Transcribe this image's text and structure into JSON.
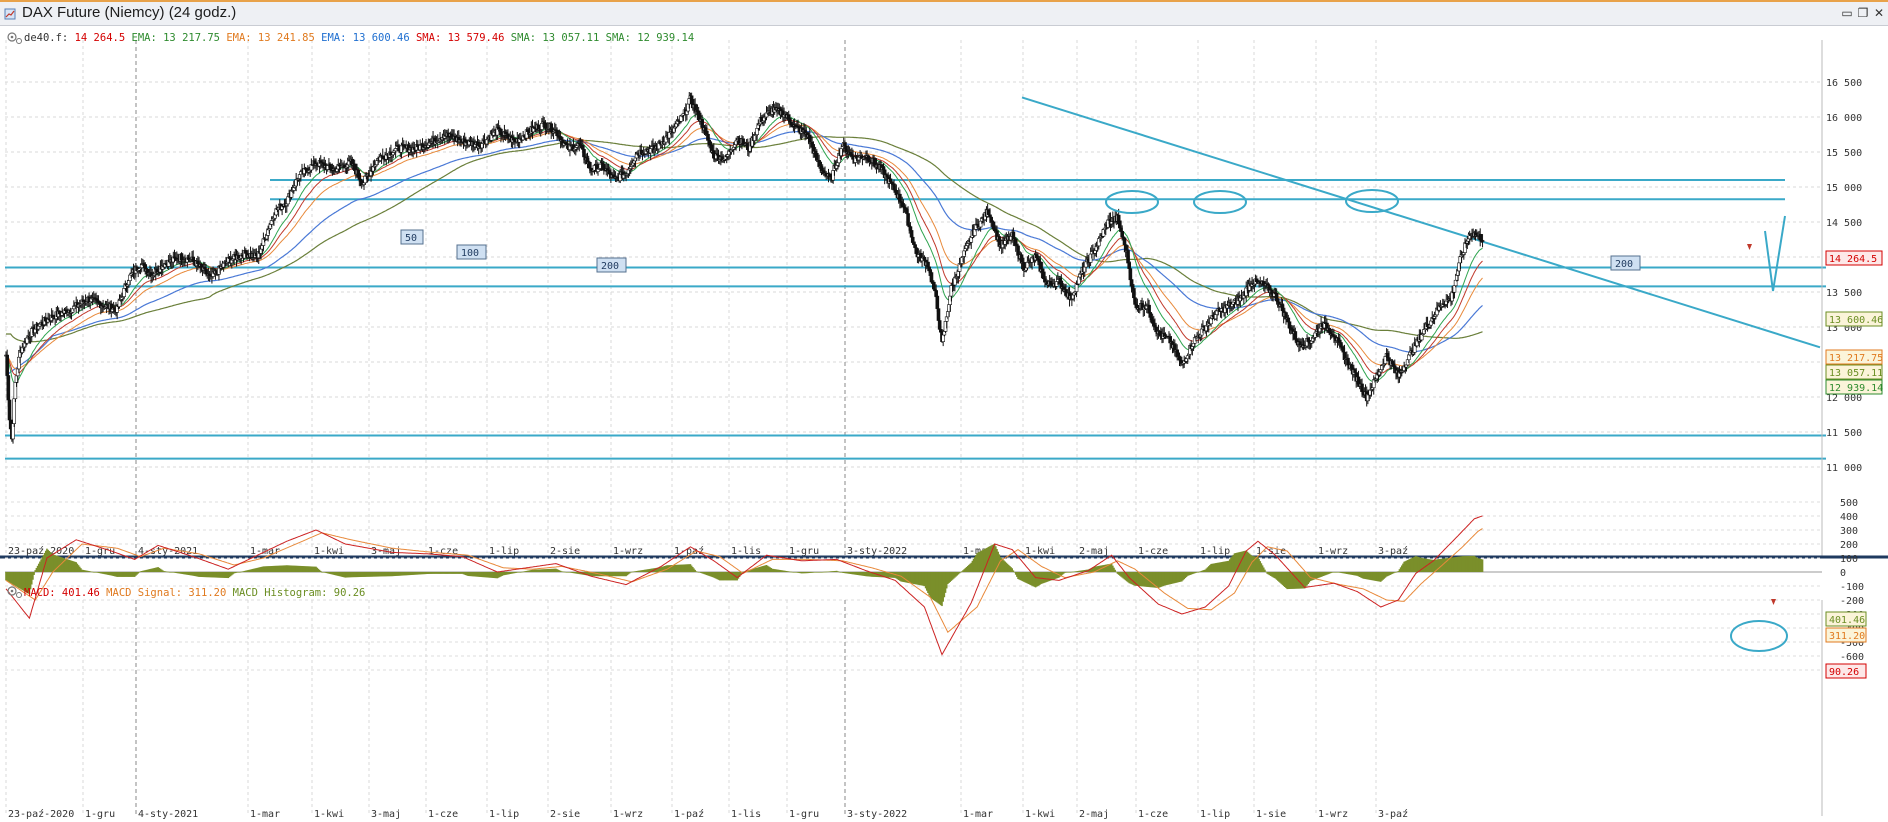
{
  "window": {
    "title": "DAX Future (Niemcy) (24 godz.)"
  },
  "price_legend": [
    {
      "label": "de40.f:",
      "value": "14 264.5",
      "color": "#d40000"
    },
    {
      "label": "EMA:",
      "value": "13 217.75",
      "color": "#2e8b2e"
    },
    {
      "label": "EMA:",
      "value": "13 241.85",
      "color": "#e07a1f"
    },
    {
      "label": "EMA:",
      "value": "13 600.46",
      "color": "#1f6fd0"
    },
    {
      "label": "SMA:",
      "value": "13 579.46",
      "color": "#d40000"
    },
    {
      "label": "SMA:",
      "value": "13 057.11",
      "color": "#2e8b2e"
    },
    {
      "label": "SMA:",
      "value": "12 939.14",
      "color": "#2e8b2e"
    }
  ],
  "macd_legend": [
    {
      "label": "MACD:",
      "value": "401.46",
      "color": "#d40000"
    },
    {
      "label": "MACD Signal:",
      "value": "311.20",
      "color": "#e07a1f"
    },
    {
      "label": "MACD Histogram:",
      "value": "90.26",
      "color": "#6b8e23"
    }
  ],
  "ma_labels": [
    "50",
    "100",
    "200",
    "200"
  ],
  "price_tags": [
    {
      "text": "14 264.5",
      "value": 14264.5,
      "color": "#d40000"
    },
    {
      "text": "13 600.46",
      "value": 13600.46,
      "color": "#6b8e23"
    },
    {
      "text": "13 217.75",
      "value": 13217.75,
      "color": "#e07a1f"
    },
    {
      "text": "13 057.11",
      "value": 13057.11,
      "color": "#6b8e23"
    },
    {
      "text": "12 939.14",
      "value": 12939.14,
      "color": "#2e8b2e"
    }
  ],
  "macd_tags": [
    {
      "text": "401.46",
      "value": 401.46,
      "color": "#6b8e23"
    },
    {
      "text": "311.20",
      "value": 311.2,
      "color": "#e07a1f"
    },
    {
      "text": "90.26",
      "value": 90.26,
      "color": "#d40000"
    }
  ],
  "colors": {
    "candle_up": "#ffffff",
    "candle_down": "#111111",
    "trendline": "#3aa9c8",
    "sma200": "#6a7f3a",
    "ema_blue": "#4a79d6",
    "ema_orange": "#e8893a",
    "ma_red": "#c0392b",
    "ma_green": "#2ea44f",
    "macd_hist": "#7a8f2a",
    "macd_line": "#cc2222",
    "signal_line": "#e8893a",
    "separator": "#1f3a5f"
  },
  "chart_data": [
    {
      "type": "candlestick",
      "yaxis_ticks": [
        11000,
        11500,
        12000,
        12500,
        13000,
        13500,
        14000,
        14500,
        15000,
        15500,
        16000,
        16500
      ],
      "yaxis_tick_labels": [
        "11 000",
        "11 500",
        "12 000",
        "12 500",
        "13 000",
        "13 500",
        "14 000",
        "14 500",
        "15 000",
        "15 500",
        "16 000",
        "16 500"
      ],
      "ylim": [
        10900,
        16600
      ],
      "x_tick_labels": [
        "23-paź-2020",
        "1-gru",
        "4-sty-2021",
        "1-mar",
        "1-kwi",
        "3-maj",
        "1-cze",
        "1-lip",
        "2-sie",
        "1-wrz",
        "1-paź",
        "1-lis",
        "1-gru",
        "3-sty-2022",
        "1-mar",
        "1-kwi",
        "2-maj",
        "1-cze",
        "1-lip",
        "1-sie",
        "1-wrz",
        "3-paź"
      ],
      "close_path": [
        [
          0,
          12600
        ],
        [
          3,
          11700
        ],
        [
          5,
          11400
        ],
        [
          8,
          12200
        ],
        [
          12,
          12650
        ],
        [
          20,
          12900
        ],
        [
          30,
          13050
        ],
        [
          40,
          13150
        ],
        [
          55,
          13250
        ],
        [
          70,
          13400
        ],
        [
          85,
          13300
        ],
        [
          95,
          13250
        ],
        [
          105,
          13700
        ],
        [
          115,
          13900
        ],
        [
          125,
          13750
        ],
        [
          135,
          13900
        ],
        [
          150,
          14000
        ],
        [
          160,
          13950
        ],
        [
          175,
          13700
        ],
        [
          190,
          13950
        ],
        [
          205,
          14050
        ],
        [
          215,
          14000
        ],
        [
          230,
          14650
        ],
        [
          240,
          14800
        ],
        [
          250,
          15150
        ],
        [
          265,
          15350
        ],
        [
          280,
          15250
        ],
        [
          295,
          15350
        ],
        [
          305,
          15050
        ],
        [
          318,
          15400
        ],
        [
          335,
          15550
        ],
        [
          350,
          15550
        ],
        [
          365,
          15650
        ],
        [
          375,
          15750
        ],
        [
          390,
          15650
        ],
        [
          405,
          15600
        ],
        [
          420,
          15800
        ],
        [
          435,
          15650
        ],
        [
          448,
          15800
        ],
        [
          460,
          15900
        ],
        [
          470,
          15800
        ],
        [
          480,
          15550
        ],
        [
          490,
          15600
        ],
        [
          500,
          15250
        ],
        [
          510,
          15300
        ],
        [
          520,
          15100
        ],
        [
          530,
          15200
        ],
        [
          540,
          15500
        ],
        [
          555,
          15550
        ],
        [
          570,
          15800
        ],
        [
          580,
          16050
        ],
        [
          585,
          16250
        ],
        [
          595,
          15900
        ],
        [
          605,
          15450
        ],
        [
          615,
          15400
        ],
        [
          625,
          15700
        ],
        [
          635,
          15550
        ],
        [
          645,
          15950
        ],
        [
          655,
          16100
        ],
        [
          665,
          16050
        ],
        [
          675,
          15850
        ],
        [
          685,
          15750
        ],
        [
          695,
          15300
        ],
        [
          705,
          15100
        ],
        [
          715,
          15600
        ],
        [
          725,
          15400
        ],
        [
          735,
          15450
        ],
        [
          748,
          15250
        ],
        [
          760,
          14950
        ],
        [
          768,
          14700
        ],
        [
          778,
          14050
        ],
        [
          788,
          13900
        ],
        [
          795,
          13400
        ],
        [
          800,
          12750
        ],
        [
          808,
          13550
        ],
        [
          818,
          14000
        ],
        [
          828,
          14400
        ],
        [
          840,
          14650
        ],
        [
          850,
          14150
        ],
        [
          860,
          14300
        ],
        [
          870,
          13850
        ],
        [
          880,
          14000
        ],
        [
          890,
          13600
        ],
        [
          900,
          13650
        ],
        [
          910,
          13400
        ],
        [
          920,
          13800
        ],
        [
          932,
          14150
        ],
        [
          942,
          14500
        ],
        [
          950,
          14550
        ],
        [
          958,
          14050
        ],
        [
          965,
          13300
        ],
        [
          975,
          13300
        ],
        [
          985,
          12900
        ],
        [
          995,
          12800
        ],
        [
          1005,
          12450
        ],
        [
          1015,
          12800
        ],
        [
          1025,
          13000
        ],
        [
          1035,
          13200
        ],
        [
          1045,
          13300
        ],
        [
          1055,
          13400
        ],
        [
          1065,
          13650
        ],
        [
          1075,
          13600
        ],
        [
          1085,
          13450
        ],
        [
          1095,
          13100
        ],
        [
          1105,
          12750
        ],
        [
          1115,
          12800
        ],
        [
          1125,
          13050
        ],
        [
          1135,
          12900
        ],
        [
          1145,
          12550
        ],
        [
          1155,
          12250
        ],
        [
          1163,
          12000
        ],
        [
          1172,
          12300
        ],
        [
          1180,
          12600
        ],
        [
          1190,
          12300
        ],
        [
          1200,
          12600
        ],
        [
          1210,
          12900
        ],
        [
          1220,
          13150
        ],
        [
          1228,
          13350
        ],
        [
          1235,
          13400
        ],
        [
          1243,
          13950
        ],
        [
          1248,
          14200
        ],
        [
          1252,
          14350
        ],
        [
          1258,
          14300
        ],
        [
          1262,
          14264
        ]
      ]
    },
    {
      "type": "bar",
      "name": "MACD Histogram",
      "yaxis_ticks": [
        -700,
        -600,
        -500,
        -400,
        -300,
        -200,
        -100,
        0,
        100,
        200,
        300,
        400,
        500
      ],
      "ylim": [
        -740,
        540
      ],
      "macd_path": [
        [
          0,
          -120
        ],
        [
          20,
          -330
        ],
        [
          35,
          100
        ],
        [
          60,
          230
        ],
        [
          90,
          150
        ],
        [
          110,
          90
        ],
        [
          130,
          190
        ],
        [
          160,
          110
        ],
        [
          190,
          20
        ],
        [
          215,
          120
        ],
        [
          240,
          220
        ],
        [
          265,
          300
        ],
        [
          290,
          200
        ],
        [
          330,
          140
        ],
        [
          360,
          130
        ],
        [
          390,
          110
        ],
        [
          420,
          0
        ],
        [
          445,
          30
        ],
        [
          470,
          60
        ],
        [
          500,
          -30
        ],
        [
          530,
          -90
        ],
        [
          560,
          40
        ],
        [
          585,
          180
        ],
        [
          605,
          80
        ],
        [
          625,
          -40
        ],
        [
          650,
          120
        ],
        [
          680,
          80
        ],
        [
          710,
          90
        ],
        [
          735,
          10
        ],
        [
          760,
          -60
        ],
        [
          785,
          -250
        ],
        [
          800,
          -590
        ],
        [
          825,
          -220
        ],
        [
          845,
          200
        ],
        [
          860,
          160
        ],
        [
          880,
          -40
        ],
        [
          900,
          -60
        ],
        [
          925,
          10
        ],
        [
          945,
          120
        ],
        [
          960,
          -40
        ],
        [
          985,
          -230
        ],
        [
          1005,
          -300
        ],
        [
          1025,
          -250
        ],
        [
          1045,
          -100
        ],
        [
          1060,
          150
        ],
        [
          1070,
          220
        ],
        [
          1085,
          120
        ],
        [
          1110,
          -110
        ],
        [
          1135,
          -80
        ],
        [
          1155,
          -140
        ],
        [
          1175,
          -250
        ],
        [
          1190,
          -200
        ],
        [
          1205,
          -10
        ],
        [
          1220,
          80
        ],
        [
          1240,
          250
        ],
        [
          1255,
          380
        ],
        [
          1262,
          401
        ]
      ],
      "signal_path": [
        [
          0,
          -60
        ],
        [
          25,
          -200
        ],
        [
          40,
          0
        ],
        [
          65,
          200
        ],
        [
          95,
          170
        ],
        [
          115,
          110
        ],
        [
          135,
          170
        ],
        [
          165,
          130
        ],
        [
          195,
          50
        ],
        [
          220,
          100
        ],
        [
          245,
          190
        ],
        [
          270,
          280
        ],
        [
          295,
          230
        ],
        [
          330,
          170
        ],
        [
          365,
          140
        ],
        [
          395,
          120
        ],
        [
          425,
          30
        ],
        [
          450,
          20
        ],
        [
          475,
          40
        ],
        [
          505,
          -10
        ],
        [
          535,
          -70
        ],
        [
          565,
          20
        ],
        [
          590,
          150
        ],
        [
          610,
          110
        ],
        [
          630,
          -10
        ],
        [
          655,
          90
        ],
        [
          685,
          90
        ],
        [
          715,
          80
        ],
        [
          740,
          30
        ],
        [
          765,
          -30
        ],
        [
          790,
          -180
        ],
        [
          805,
          -430
        ],
        [
          830,
          -250
        ],
        [
          850,
          80
        ],
        [
          865,
          160
        ],
        [
          885,
          40
        ],
        [
          905,
          -40
        ],
        [
          930,
          0
        ],
        [
          950,
          80
        ],
        [
          965,
          20
        ],
        [
          990,
          -150
        ],
        [
          1010,
          -260
        ],
        [
          1030,
          -270
        ],
        [
          1050,
          -150
        ],
        [
          1065,
          70
        ],
        [
          1078,
          180
        ],
        [
          1095,
          150
        ],
        [
          1115,
          -40
        ],
        [
          1140,
          -90
        ],
        [
          1160,
          -120
        ],
        [
          1180,
          -200
        ],
        [
          1195,
          -210
        ],
        [
          1210,
          -80
        ],
        [
          1225,
          30
        ],
        [
          1245,
          180
        ],
        [
          1258,
          290
        ],
        [
          1262,
          311
        ]
      ]
    }
  ]
}
